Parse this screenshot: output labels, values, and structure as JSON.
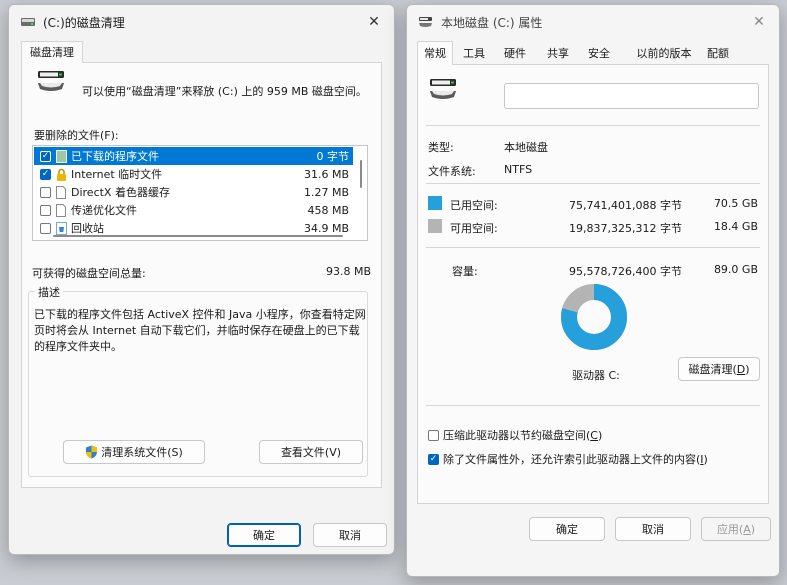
{
  "disk_cleanup": {
    "title": "(C:)的磁盘清理",
    "tab": "磁盘清理",
    "intro": "可以使用“磁盘清理”来释放 (C:) 上的 959 MB 磁盘空间。",
    "files_label": "要删除的文件(F):",
    "files": [
      {
        "name": "已下载的程序文件",
        "size": "0 字节",
        "checked": true,
        "selected": true,
        "icon": "folder-icon"
      },
      {
        "name": "Internet 临时文件",
        "size": "31.6 MB",
        "checked": true,
        "selected": false,
        "icon": "lock-icon"
      },
      {
        "name": "DirectX 着色器缓存",
        "size": "1.27 MB",
        "checked": false,
        "selected": false,
        "icon": "file-icon"
      },
      {
        "name": "传递优化文件",
        "size": "458 MB",
        "checked": false,
        "selected": false,
        "icon": "file-icon"
      },
      {
        "name": "回收站",
        "size": "34.9 MB",
        "checked": false,
        "selected": false,
        "icon": "recycle-bin-icon"
      }
    ],
    "total_label": "可获得的磁盘空间总量:",
    "total_value": "93.8 MB",
    "description_legend": "描述",
    "description_text": "已下载的程序文件包括 ActiveX 控件和 Java 小程序，你查看特定网页时将会从 Internet 自动下载它们，并临时保存在硬盘上的已下载的程序文件夹中。",
    "cleanup_system_button": "清理系统文件(S)",
    "view_files_button": "查看文件(V)",
    "ok_button": "确定",
    "cancel_button": "取消"
  },
  "properties": {
    "title": "本地磁盘 (C:) 属性",
    "tabs": [
      "常规",
      "工具",
      "硬件",
      "共享",
      "安全",
      "以前的版本",
      "配额"
    ],
    "active_tab": 0,
    "type_label": "类型:",
    "type_value": "本地磁盘",
    "fs_label": "文件系统:",
    "fs_value": "NTFS",
    "used_label": "已用空间:",
    "used_bytes": "75,741,401,088 字节",
    "used_gb": "70.5 GB",
    "free_label": "可用空间:",
    "free_bytes": "19,837,325,312 字节",
    "free_gb": "18.4 GB",
    "capacity_label": "容量:",
    "capacity_bytes": "95,578,726,400 字节",
    "capacity_gb": "89.0 GB",
    "used_fraction": 0.792,
    "drive_label": "驱动器 C:",
    "disk_cleanup_button": "磁盘清理(",
    "disk_cleanup_key": "D",
    "compress_label": "压缩此驱动器以节约磁盘空间(",
    "compress_key": "C",
    "compress_checked": false,
    "index_label": "除了文件属性外，还允许索引此驱动器上文件的内容(",
    "index_key": "I",
    "index_checked": true,
    "ok_button": "确定",
    "cancel_button": "取消",
    "apply_button": "应用(",
    "apply_key": "A",
    "close_symbol": "✕"
  },
  "colors": {
    "used": "#26a0da",
    "free": "#b4b4b4",
    "accent": "#0078d4"
  }
}
